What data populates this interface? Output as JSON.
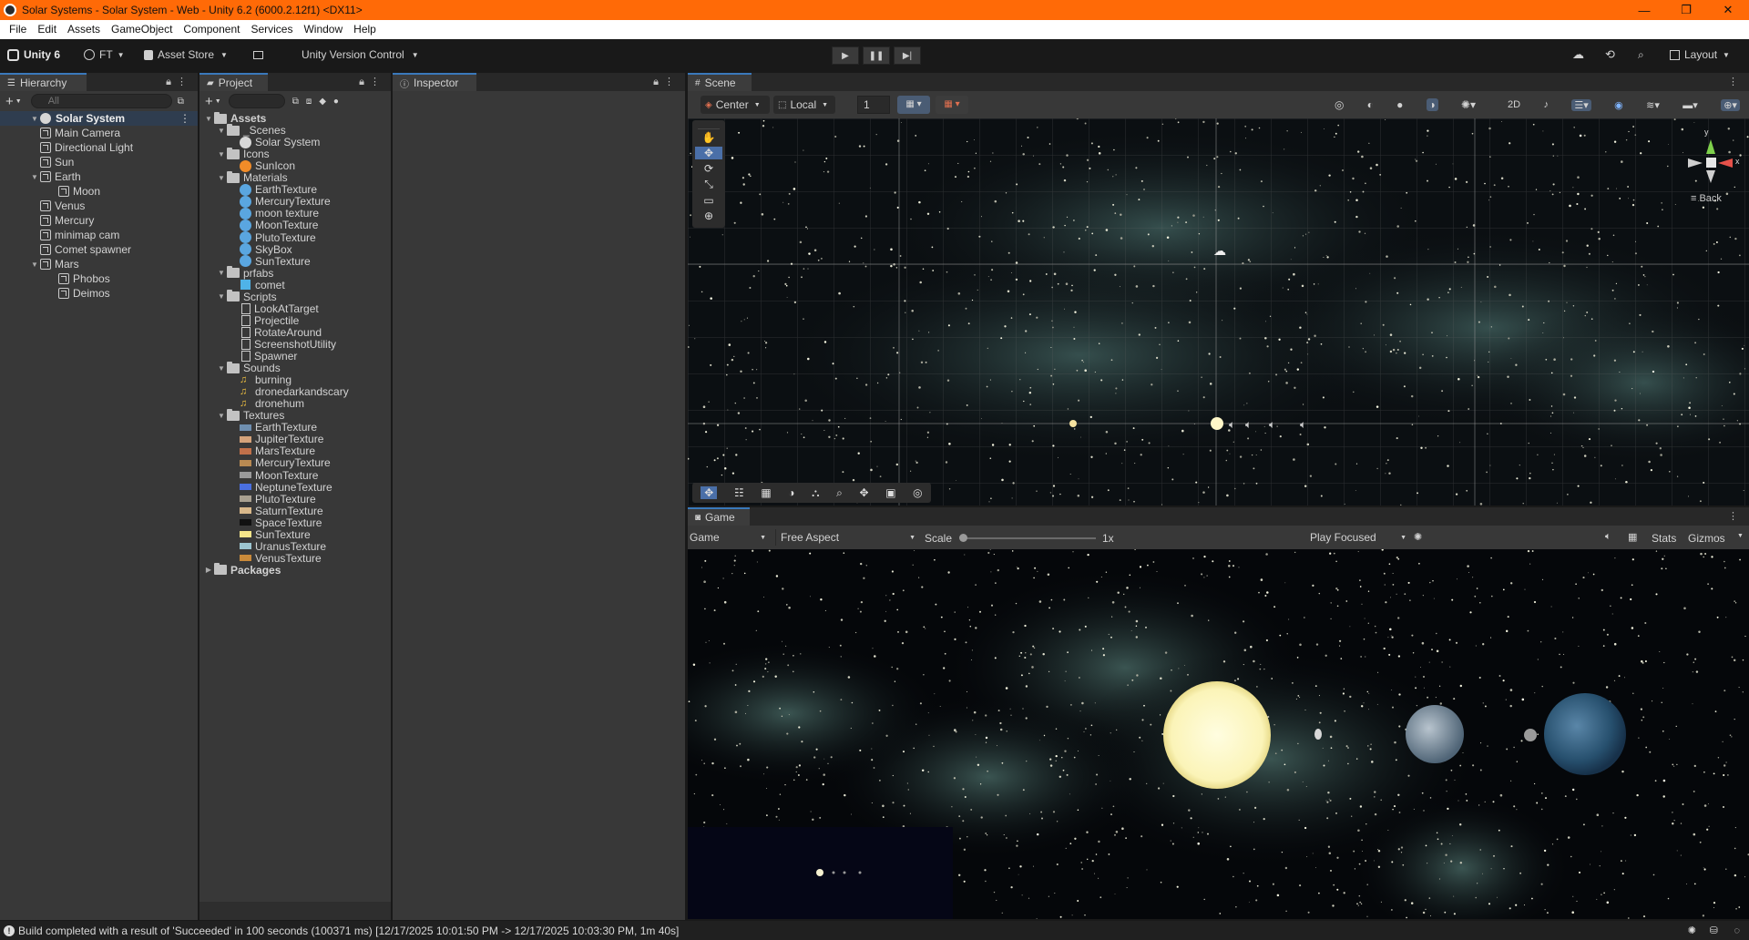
{
  "window": {
    "title": "Solar Systems - Solar System - Web - Unity 6.2 (6000.2.12f1) <DX11>",
    "controls": [
      "—",
      "❐",
      "✕"
    ]
  },
  "menu": [
    "File",
    "Edit",
    "Assets",
    "GameObject",
    "Component",
    "Services",
    "Window",
    "Help"
  ],
  "toolbar": {
    "unity_label": "Unity 6",
    "account_label": "FT",
    "asset_store_label": "Asset Store",
    "version_control_label": "Unity Version Control",
    "layout_label": "Layout"
  },
  "hierarchy": {
    "tab_label": "Hierarchy",
    "search_placeholder": "All",
    "root": "Solar System",
    "items": [
      {
        "label": "Main Camera",
        "depth": 1,
        "expand": ""
      },
      {
        "label": "Directional Light",
        "depth": 1,
        "expand": ""
      },
      {
        "label": "Sun",
        "depth": 1,
        "expand": ""
      },
      {
        "label": "Earth",
        "depth": 1,
        "expand": "▼"
      },
      {
        "label": "Moon",
        "depth": 2,
        "expand": ""
      },
      {
        "label": "Venus",
        "depth": 1,
        "expand": ""
      },
      {
        "label": "Mercury",
        "depth": 1,
        "expand": ""
      },
      {
        "label": "minimap cam",
        "depth": 1,
        "expand": ""
      },
      {
        "label": "Comet spawner",
        "depth": 1,
        "expand": ""
      },
      {
        "label": "Mars",
        "depth": 1,
        "expand": "▼"
      },
      {
        "label": "Phobos",
        "depth": 2,
        "expand": ""
      },
      {
        "label": "Deimos",
        "depth": 2,
        "expand": ""
      }
    ]
  },
  "project": {
    "tab_label": "Project",
    "tree": [
      {
        "label": "Assets",
        "depth": 0,
        "kind": "folder-bold",
        "expand": "▼"
      },
      {
        "label": "_Scenes",
        "depth": 1,
        "kind": "folder",
        "expand": "▼"
      },
      {
        "label": "Solar System",
        "depth": 2,
        "kind": "scene",
        "expand": ""
      },
      {
        "label": "Icons",
        "depth": 1,
        "kind": "folder",
        "expand": "▼"
      },
      {
        "label": "SunIcon",
        "depth": 2,
        "kind": "sunicon",
        "expand": ""
      },
      {
        "label": "Materials",
        "depth": 1,
        "kind": "folder",
        "expand": "▼"
      },
      {
        "label": "EarthTexture",
        "depth": 2,
        "kind": "material",
        "expand": ""
      },
      {
        "label": "MercuryTexture",
        "depth": 2,
        "kind": "material",
        "expand": ""
      },
      {
        "label": "moon texture",
        "depth": 2,
        "kind": "material",
        "expand": ""
      },
      {
        "label": "MoonTexture",
        "depth": 2,
        "kind": "material",
        "expand": ""
      },
      {
        "label": "PlutoTexture",
        "depth": 2,
        "kind": "material",
        "expand": ""
      },
      {
        "label": "SkyBox",
        "depth": 2,
        "kind": "material",
        "expand": ""
      },
      {
        "label": "SunTexture",
        "depth": 2,
        "kind": "material",
        "expand": ""
      },
      {
        "label": "prfabs",
        "depth": 1,
        "kind": "folder",
        "expand": "▼"
      },
      {
        "label": "comet",
        "depth": 2,
        "kind": "prefab",
        "expand": ""
      },
      {
        "label": "Scripts",
        "depth": 1,
        "kind": "folder",
        "expand": "▼"
      },
      {
        "label": "LookAtTarget",
        "depth": 2,
        "kind": "script",
        "expand": ""
      },
      {
        "label": "Projectile",
        "depth": 2,
        "kind": "script",
        "expand": ""
      },
      {
        "label": "RotateAround",
        "depth": 2,
        "kind": "script",
        "expand": ""
      },
      {
        "label": "ScreenshotUtility",
        "depth": 2,
        "kind": "script",
        "expand": ""
      },
      {
        "label": "Spawner",
        "depth": 2,
        "kind": "script",
        "expand": ""
      },
      {
        "label": "Sounds",
        "depth": 1,
        "kind": "folder",
        "expand": "▼"
      },
      {
        "label": "burning",
        "depth": 2,
        "kind": "audio",
        "expand": ""
      },
      {
        "label": "dronedarkandscary",
        "depth": 2,
        "kind": "audio",
        "expand": ""
      },
      {
        "label": "dronehum",
        "depth": 2,
        "kind": "audio",
        "expand": ""
      },
      {
        "label": "Textures",
        "depth": 1,
        "kind": "folder",
        "expand": "▼"
      },
      {
        "label": "EarthTexture",
        "depth": 2,
        "kind": "tex",
        "color": "#6f8fb0",
        "expand": ""
      },
      {
        "label": "JupiterTexture",
        "depth": 2,
        "kind": "tex",
        "color": "#d4a27a",
        "expand": ""
      },
      {
        "label": "MarsTexture",
        "depth": 2,
        "kind": "tex",
        "color": "#c0704a",
        "expand": ""
      },
      {
        "label": "MercuryTexture",
        "depth": 2,
        "kind": "tex",
        "color": "#b98a52",
        "expand": ""
      },
      {
        "label": "MoonTexture",
        "depth": 2,
        "kind": "tex",
        "color": "#9a9a9a",
        "expand": ""
      },
      {
        "label": "NeptuneTexture",
        "depth": 2,
        "kind": "tex",
        "color": "#4a6fe0",
        "expand": ""
      },
      {
        "label": "PlutoTexture",
        "depth": 2,
        "kind": "tex",
        "color": "#a9a090",
        "expand": ""
      },
      {
        "label": "SaturnTexture",
        "depth": 2,
        "kind": "tex",
        "color": "#d9b88a",
        "expand": ""
      },
      {
        "label": "SpaceTexture",
        "depth": 2,
        "kind": "tex",
        "color": "#111111",
        "expand": ""
      },
      {
        "label": "SunTexture",
        "depth": 2,
        "kind": "tex",
        "color": "#f5e58a",
        "expand": ""
      },
      {
        "label": "UranusTexture",
        "depth": 2,
        "kind": "tex",
        "color": "#9cc5d0",
        "expand": ""
      },
      {
        "label": "VenusTexture",
        "depth": 2,
        "kind": "tex",
        "color": "#c98a3a",
        "expand": ""
      },
      {
        "label": "Packages",
        "depth": 0,
        "kind": "folder-bold",
        "expand": "▶"
      }
    ]
  },
  "inspector": {
    "tab_label": "Inspector"
  },
  "scene": {
    "tab_label": "Scene",
    "pivot_label": "Center",
    "space_label": "Local",
    "grid_value": "1",
    "gizmo_back_label": "≡ Back",
    "gizmo_axes": [
      "y",
      "x"
    ]
  },
  "game": {
    "tab_label": "Game",
    "display_label": "Game",
    "aspect_label": "Free Aspect",
    "scale_label": "Scale",
    "scale_value": "1x",
    "play_mode_label": "Play Focused",
    "stats_label": "Stats",
    "gizmos_label": "Gizmos"
  },
  "status": {
    "message": "Build completed with a result of 'Succeeded' in 100 seconds (100371 ms) [12/17/2025 10:01:50 PM -> 12/17/2025 10:03:30 PM, 1m 40s]"
  }
}
